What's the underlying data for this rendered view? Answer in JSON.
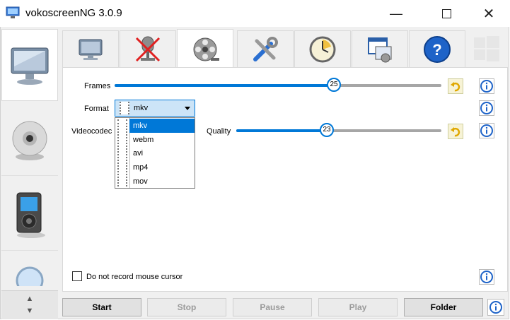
{
  "window": {
    "title": "vokoscreenNG 3.0.9"
  },
  "settings": {
    "frames_label": "Frames",
    "frames_value": "25",
    "frames_fraction": 0.67,
    "format_label": "Format",
    "format_selected": "mkv",
    "format_options": [
      "mkv",
      "webm",
      "avi",
      "mp4",
      "mov"
    ],
    "videocodec_label": "Videocodec",
    "quality_label": "Quality",
    "quality_value": "23",
    "quality_fraction": 0.44,
    "mouse_cursor_label": "Do not record mouse cursor"
  },
  "buttons": {
    "start": "Start",
    "stop": "Stop",
    "pause": "Pause",
    "play": "Play",
    "folder": "Folder"
  },
  "colors": {
    "accent": "#0078d7",
    "undo_bg": "#f7f3d6",
    "disabled_text": "#9a9a9a"
  },
  "icons": {
    "sidebar": [
      "monitor-icon",
      "webcam-icon",
      "media-player-icon",
      "magnifier-icon"
    ],
    "tabs": [
      "monitor-icon",
      "microphone-muted-icon",
      "film-reel-icon",
      "tools-icon",
      "clock-icon",
      "window-settings-icon",
      "help-icon",
      "windows-logo-icon"
    ]
  }
}
